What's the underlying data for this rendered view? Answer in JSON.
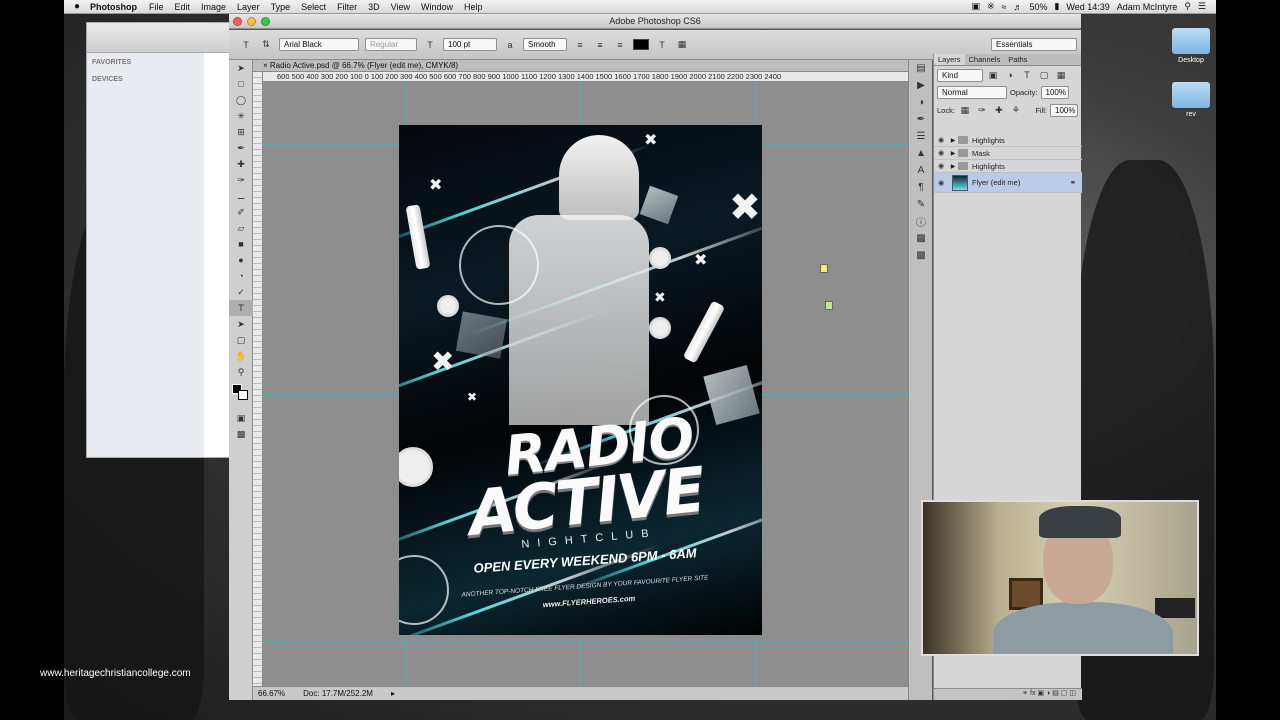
{
  "menubar": {
    "apple": "",
    "app": "Photoshop",
    "items": [
      "File",
      "Edit",
      "Image",
      "Layer",
      "Type",
      "Select",
      "Filter",
      "3D",
      "View",
      "Window",
      "Help"
    ],
    "battery": "50%",
    "clock": "Wed 14:39",
    "user": "Adam McIntyre"
  },
  "finder": {
    "favorites": "FAVORITES",
    "devices": "DEVICES"
  },
  "window": {
    "title": "Adobe Photoshop CS6"
  },
  "options": {
    "font_family": "Arial Black",
    "font_style": "Regular",
    "font_size": "100 pt",
    "antialias": "Smooth",
    "workspace": "Essentials"
  },
  "document": {
    "tab": "Radio Active.psd @ 66.7% (Flyer (edit me), CMYK/8)",
    "ruler": "600  500  400  300  200  100    0      100  200  300  400  500  600  700  800  900  1000 1100 1200 1300 1400 1500 1600 1700 1800 1900 2000 2100 2200 2300 2400",
    "zoom": "66.67%",
    "doc_size": "Doc: 17.7M/252.2M"
  },
  "flyer": {
    "line1": "RADIO",
    "line2": "ACTIVE",
    "subtitle": "NIGHTCLUB",
    "open": "OPEN EVERY WEEKEND 6PM - 6AM",
    "tagline": "ANOTHER TOP-NOTCH FREE FLYER DESIGN BY YOUR FAVOURITE FLYER SITE",
    "site": "www.FLYERHEROES.com"
  },
  "layers_panel": {
    "tabs": [
      "Layers",
      "Channels",
      "Paths"
    ],
    "kind": "Kind",
    "blend_mode": "Normal",
    "opacity_label": "Opacity:",
    "opacity": "100%",
    "lock_label": "Lock:",
    "fill_label": "Fill:",
    "fill": "100%",
    "layers": [
      {
        "name": "Highlights",
        "type": "group"
      },
      {
        "name": "Mask",
        "type": "group"
      },
      {
        "name": "Highlights",
        "type": "group"
      },
      {
        "name": "Flyer (edit me)",
        "type": "smart-object",
        "selected": true
      }
    ],
    "footer": "fx"
  },
  "desktop": {
    "icon1": "Desktop",
    "icon2": "rev"
  },
  "watermark": "www.heritagechristiancollege.com"
}
